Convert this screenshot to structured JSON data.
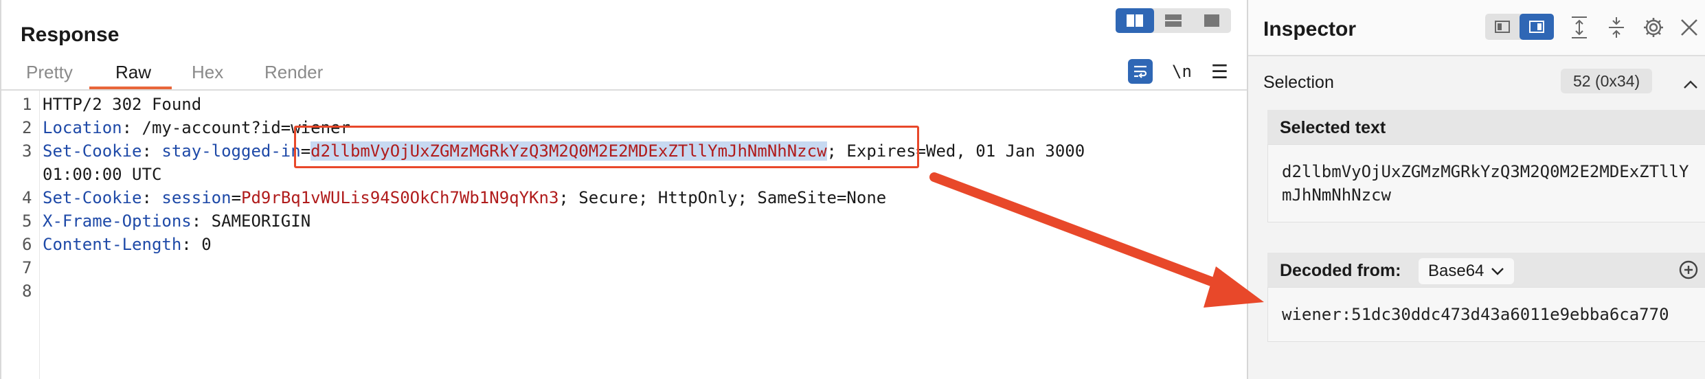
{
  "response": {
    "title": "Response",
    "tabs": [
      "Pretty",
      "Raw",
      "Hex",
      "Render"
    ],
    "active_tab": "Raw",
    "newline_label": "\\n",
    "lines": [
      {
        "no": "1"
      },
      {
        "no": "2"
      },
      {
        "no": "3"
      },
      {
        "no": "4"
      },
      {
        "no": "5"
      },
      {
        "no": "6"
      },
      {
        "no": "7"
      },
      {
        "no": "8"
      }
    ],
    "code": {
      "l1": "HTTP/2 302 Found",
      "l2_key": "Location",
      "l2_val": ": /my-account?id=wiener",
      "l3_key": "Set-Cookie",
      "l3_sep": ": ",
      "l3_name": "stay-logged-in",
      "l3_eq": "=",
      "l3_value": "d2llbmVyOjUxZGMzMGRkYzQ3M2Q0M2E2MDExZTllYmJhNmNhNzcw",
      "l3_rest": "; Expires=Wed, 01 Jan 3000",
      "l3_cont": "01:00:00 UTC",
      "l4_key": "Set-Cookie",
      "l4_sep": ": ",
      "l4_name": "session",
      "l4_eq": "=",
      "l4_value": "Pd9rBq1vWULis94S0OkCh7Wb1N9qYKn3",
      "l4_rest": "; Secure; HttpOnly; SameSite=None",
      "l5_key": "X-Frame-Options",
      "l5_val": ": SAMEORIGIN",
      "l6_key": "Content-Length",
      "l6_val": ": 0"
    }
  },
  "inspector": {
    "title": "Inspector",
    "selection_label": "Selection",
    "selection_count": "52 (0x34)",
    "selected_text_title": "Selected text",
    "selected_text": "d2llbmVyOjUxZGMzMGRkYzQ3M2Q0M2E2MDExZTllYmJhNmNhNzcw",
    "decoded_from_label": "Decoded from:",
    "decoder": "Base64",
    "decoded_text": "wiener:51dc30ddc473d43a6011e9ebba6ca770"
  },
  "colors": {
    "accent": "#2f67b5",
    "tab_underline": "#e8663a",
    "annotation": "#e8482a",
    "header_key": "#1f4aa8",
    "header_value": "#b01c1c",
    "selection_bg": "#c7d9f1"
  },
  "icons": [
    "split-horizontal-icon",
    "split-vertical-icon",
    "single-pane-icon",
    "wrap-lines-icon",
    "newline-toggle-icon",
    "menu-icon",
    "expand-icon",
    "collapse-icon",
    "gear-icon",
    "close-icon",
    "chevron-up-icon",
    "chevron-down-icon",
    "add-icon"
  ]
}
